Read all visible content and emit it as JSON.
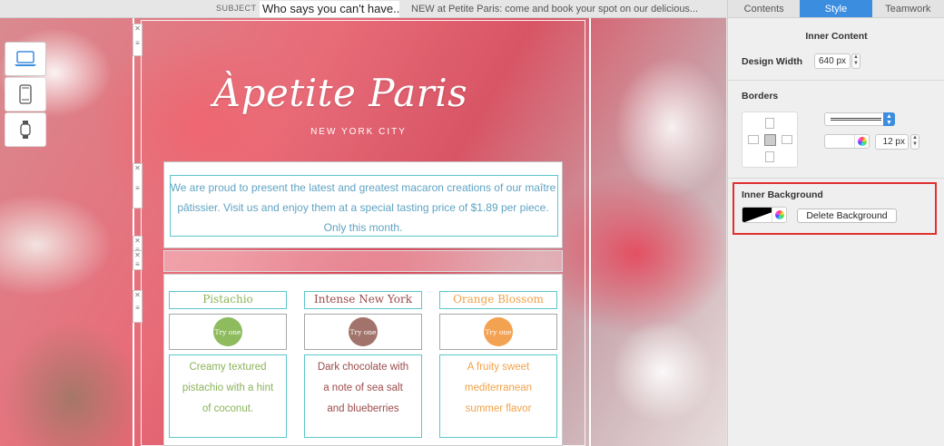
{
  "subject": {
    "label": "SUBJECT",
    "value": "Who says you can't have...",
    "preheader": "NEW at Petite Paris: come and book your spot on our delicious..."
  },
  "devices": [
    {
      "name": "desktop",
      "icon": "laptop-icon"
    },
    {
      "name": "mobile",
      "icon": "phone-icon"
    },
    {
      "name": "watch",
      "icon": "watch-icon"
    }
  ],
  "email": {
    "logo": "Àpetite Paris",
    "city": "NEW YORK CITY",
    "intro": "We are proud to present the latest and greatest macaron creations of our maître pâtissier. Visit us and enjoy them at a special tasting price of $1.89 per piece. Only this month.",
    "products": [
      {
        "name": "Pistachio",
        "badge": "Try one",
        "desc": "Creamy textured pistachio with a hint of coconut.",
        "color": "#8bb35a",
        "badge_color": "#8fbb5f"
      },
      {
        "name": "Intense New York",
        "badge": "Try one",
        "desc": "Dark chocolate with a note of sea salt and blueberries",
        "color": "#9c4b4b",
        "badge_color": "#a2736a"
      },
      {
        "name": "Orange Blossom",
        "badge": "Try one",
        "desc": "A fruity sweet mediterranean summer flavor",
        "color": "#f0a24a",
        "badge_color": "#f3a252"
      }
    ]
  },
  "panel": {
    "tabs": [
      "Contents",
      "Style",
      "Teamwork"
    ],
    "active_tab": "Style",
    "inner_content": {
      "title": "Inner Content",
      "design_width_label": "Design Width",
      "design_width_value": "640 px"
    },
    "borders": {
      "title": "Borders",
      "width_value": "12 px"
    },
    "inner_background": {
      "title": "Inner Background",
      "delete_label": "Delete Background"
    }
  },
  "colors": {
    "accent_blue": "#3b8de0",
    "highlight_red": "#e03030",
    "teal_border": "#5cc6cc",
    "intro_text": "#5fa3c3"
  }
}
